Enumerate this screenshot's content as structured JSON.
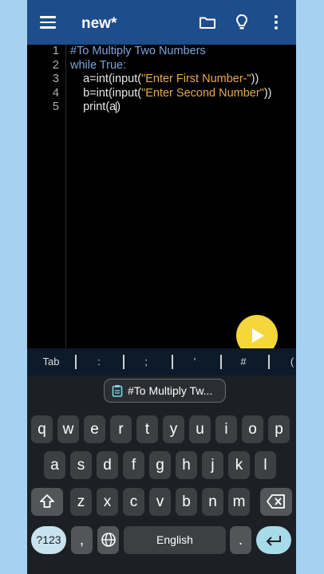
{
  "app": {
    "title": "new*"
  },
  "editor": {
    "line_numbers": [
      "1",
      "2",
      "3",
      "4",
      "5"
    ],
    "lines": [
      {
        "segments": [
          {
            "t": "#To Multiply Two Numbers",
            "c": "comment"
          }
        ]
      },
      {
        "segments": [
          {
            "t": "while True:",
            "c": "kw"
          }
        ]
      },
      {
        "segments": [
          {
            "t": "    a=int(input(",
            "c": "plain"
          },
          {
            "t": "\"Enter First Number-\"",
            "c": "str"
          },
          {
            "t": "))",
            "c": "plain"
          }
        ]
      },
      {
        "segments": [
          {
            "t": "    b=int(input(",
            "c": "plain"
          },
          {
            "t": "\"Enter Second Number\"",
            "c": "str"
          },
          {
            "t": "))",
            "c": "plain"
          }
        ]
      },
      {
        "segments": [
          {
            "t": "    print(a",
            "c": "plain"
          },
          {
            "t": "|",
            "c": "caret"
          },
          {
            "t": ")",
            "c": "plain"
          }
        ]
      }
    ]
  },
  "symbol_bar": [
    "Tab",
    ":",
    ";",
    "'",
    "#",
    "("
  ],
  "suggestion": {
    "text": "#To Multiply Tw..."
  },
  "keyboard": {
    "row1": [
      "q",
      "w",
      "e",
      "r",
      "t",
      "y",
      "u",
      "i",
      "o",
      "p"
    ],
    "row2": [
      "a",
      "s",
      "d",
      "f",
      "g",
      "h",
      "j",
      "k",
      "l"
    ],
    "row3": [
      "z",
      "x",
      "c",
      "v",
      "b",
      "n",
      "m"
    ],
    "numbers_label": "?123",
    "comma": ",",
    "space_label": "English",
    "period": "."
  },
  "colors": {
    "appbar": "#1e4d8c",
    "run_button": "#f5d63b",
    "background": "#a6d2f2"
  },
  "icons": [
    "menu-icon",
    "folder-icon",
    "lightbulb-icon",
    "more-vert-icon",
    "play-icon",
    "clipboard-icon",
    "shift-icon",
    "backspace-icon",
    "globe-icon",
    "enter-icon"
  ]
}
